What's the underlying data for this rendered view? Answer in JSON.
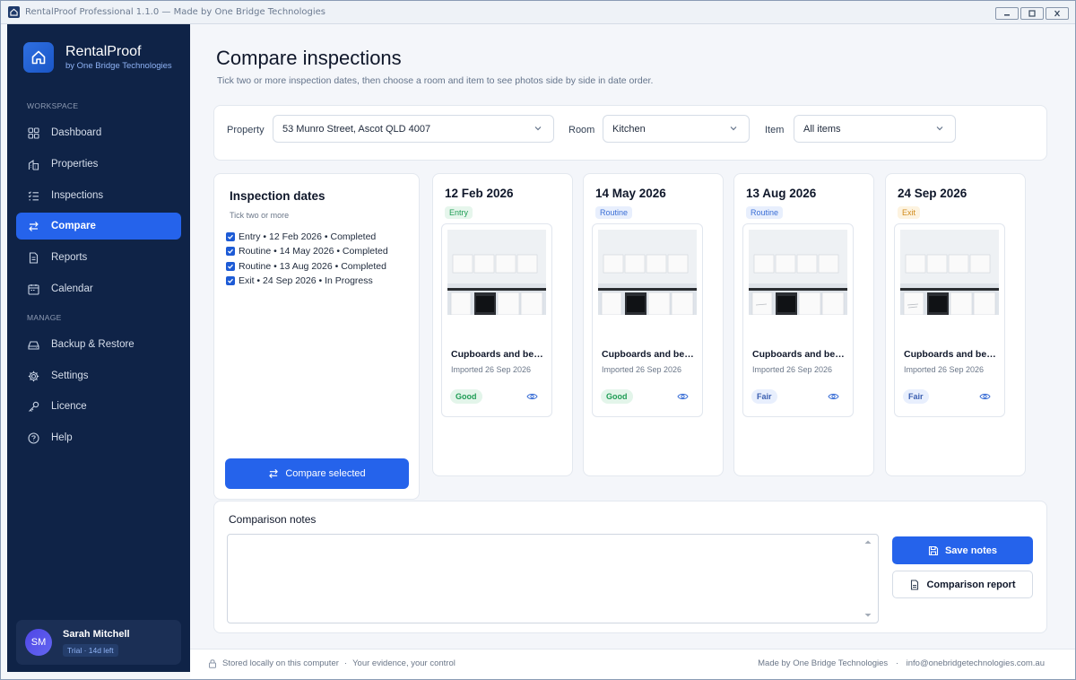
{
  "window": {
    "title": "RentalProof Professional 1.1.0 — Made by One Bridge Technologies"
  },
  "brand": {
    "name": "RentalProof",
    "sub": "by One Bridge Technologies",
    "icon": "home-icon",
    "color": "#2563eb"
  },
  "sidebar": {
    "workspace_label": "WORKSPACE",
    "manage_label": "MANAGE",
    "items": [
      {
        "label": "Dashboard",
        "icon": "grid-icon"
      },
      {
        "label": "Properties",
        "icon": "building-icon"
      },
      {
        "label": "Inspections",
        "icon": "checklist-icon"
      },
      {
        "label": "Compare",
        "icon": "swap-icon",
        "active": true
      },
      {
        "label": "Reports",
        "icon": "document-icon"
      },
      {
        "label": "Calendar",
        "icon": "calendar-icon"
      },
      {
        "label": "Backup & Restore",
        "icon": "drive-icon"
      },
      {
        "label": "Settings",
        "icon": "gear-icon"
      },
      {
        "label": "Licence",
        "icon": "key-icon"
      },
      {
        "label": "Help",
        "icon": "help-icon"
      }
    ]
  },
  "user": {
    "initials": "SM",
    "name": "Sarah Mitchell",
    "trial": "Trial · 14d left"
  },
  "page": {
    "title": "Compare inspections",
    "subtitle": "Tick two or more inspection dates, then choose a room and item to see photos side by side in date order."
  },
  "filters": {
    "property_label": "Property",
    "property_value": "53 Munro Street, Ascot QLD 4007",
    "room_label": "Room",
    "room_value": "Kitchen",
    "item_label": "Item",
    "item_value": "All items"
  },
  "dates": {
    "title": "Inspection dates",
    "hint": "Tick two or more",
    "items": [
      {
        "label": "Entry • 12 Feb 2026 • Completed",
        "checked": true
      },
      {
        "label": "Routine • 14 May 2026 • Completed",
        "checked": true
      },
      {
        "label": "Routine • 13 Aug 2026 • Completed",
        "checked": true
      },
      {
        "label": "Exit • 24 Sep 2026 • In Progress",
        "checked": true
      }
    ],
    "compare_button": "Compare selected"
  },
  "columns": [
    {
      "date": "12 Feb 2026",
      "type": "Entry",
      "caption": "Cupboards and benches",
      "meta": "Imported 26 Sep 2026",
      "condition": "Good"
    },
    {
      "date": "14 May 2026",
      "type": "Routine",
      "caption": "Cupboards and benches",
      "meta": "Imported 26 Sep 2026",
      "condition": "Good"
    },
    {
      "date": "13 Aug 2026",
      "type": "Routine",
      "caption": "Cupboards and benches",
      "meta": "Imported 26 Sep 2026",
      "condition": "Fair"
    },
    {
      "date": "24 Sep 2026",
      "type": "Exit",
      "caption": "Cupboards and benches",
      "meta": "Imported 26 Sep 2026",
      "condition": "Fair"
    }
  ],
  "notes": {
    "title": "Comparison notes",
    "value": "",
    "save_button": "Save notes",
    "report_button": "Comparison report"
  },
  "footer": {
    "left_1": "Stored locally on this computer",
    "left_2": "Your evidence, your control",
    "right_1": "Made by One Bridge Technologies",
    "right_2": "info@onebridgetechnologies.com.au"
  },
  "colors": {
    "sidebar_bg": "#0f2347",
    "accent": "#2563eb",
    "entry_badge_bg": "#e6f6ec",
    "entry_badge_fg": "#1f9d55",
    "routine_badge_bg": "#e8effd",
    "routine_badge_fg": "#3b6fd6",
    "exit_badge_bg": "#fdf3e0",
    "exit_badge_fg": "#d18b1c",
    "good_bg": "#e3f5ea",
    "good_fg": "#1f9d55",
    "fair_bg": "#e8effd",
    "fair_fg": "#3b5fb0"
  }
}
